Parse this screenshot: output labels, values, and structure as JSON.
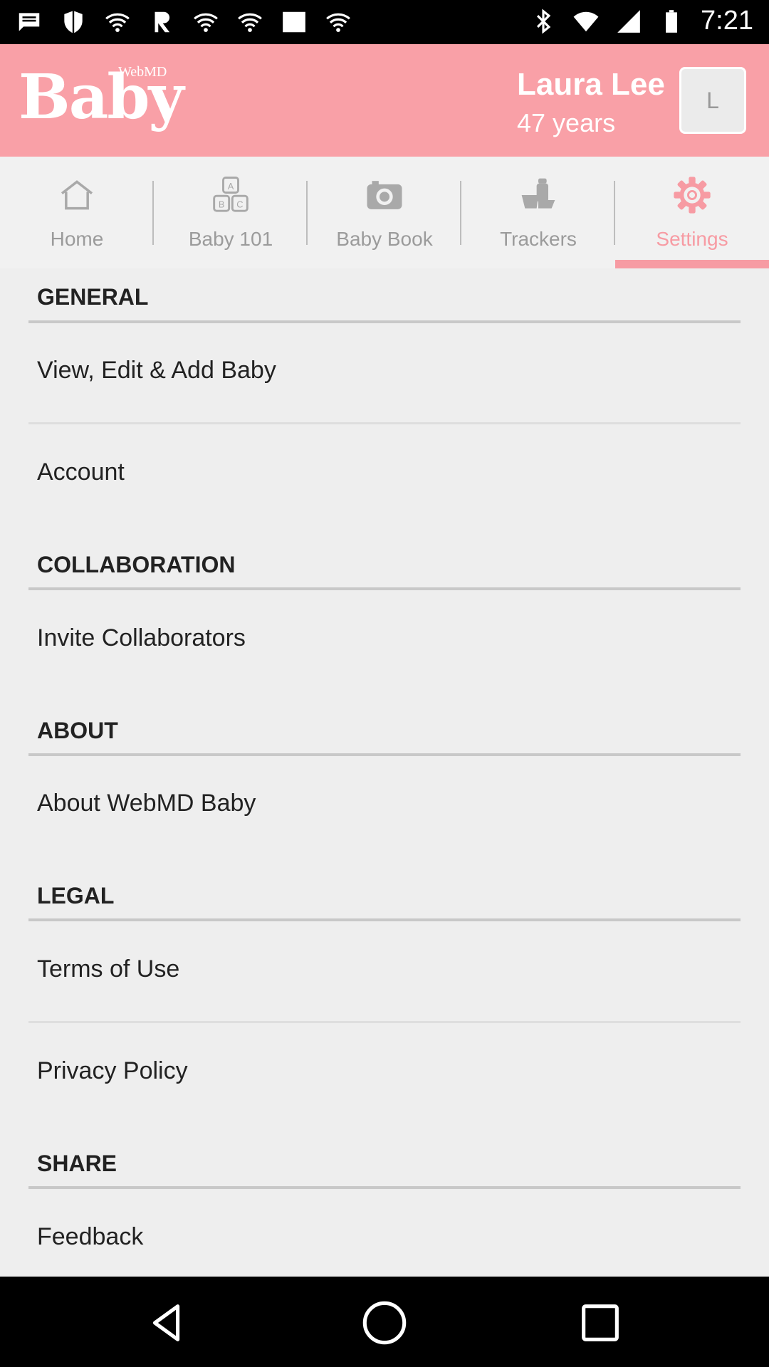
{
  "status_bar": {
    "time": "7:21",
    "left_icons": [
      "message-icon",
      "shield-icon",
      "wifi-icon",
      "r-app-icon",
      "wifi-icon",
      "wifi-icon",
      "image-icon",
      "wifi-icon"
    ],
    "right_icons": [
      "bluetooth-icon",
      "wifi-signal-icon",
      "cell-signal-icon",
      "battery-icon"
    ]
  },
  "header": {
    "logo_word": "Baby",
    "logo_brand": "WebMD",
    "user_name": "Laura Lee",
    "user_age": "47 years",
    "avatar_initial": "L",
    "background_color": "#f9a0a7"
  },
  "tabs": [
    {
      "label": "Home",
      "icon": "home-icon",
      "active": false
    },
    {
      "label": "Baby 101",
      "icon": "abc-blocks-icon",
      "active": false
    },
    {
      "label": "Baby Book",
      "icon": "camera-icon",
      "active": false
    },
    {
      "label": "Trackers",
      "icon": "bottle-diaper-icon",
      "active": false
    },
    {
      "label": "Settings",
      "icon": "gear-icon",
      "active": true
    }
  ],
  "accent_color": "#f79ba3",
  "sections": {
    "general": {
      "header": "GENERAL",
      "items": [
        "View, Edit & Add Baby",
        "Account"
      ]
    },
    "collaboration": {
      "header": "COLLABORATION",
      "items": [
        "Invite Collaborators"
      ]
    },
    "about": {
      "header": "ABOUT",
      "items": [
        "About WebMD Baby"
      ]
    },
    "legal": {
      "header": "LEGAL",
      "items": [
        "Terms of Use",
        "Privacy Policy"
      ]
    },
    "share": {
      "header": "SHARE",
      "items": [
        "Feedback"
      ]
    }
  },
  "nav_bar": {
    "buttons": [
      "back-icon",
      "home-circle-icon",
      "recents-icon"
    ]
  }
}
